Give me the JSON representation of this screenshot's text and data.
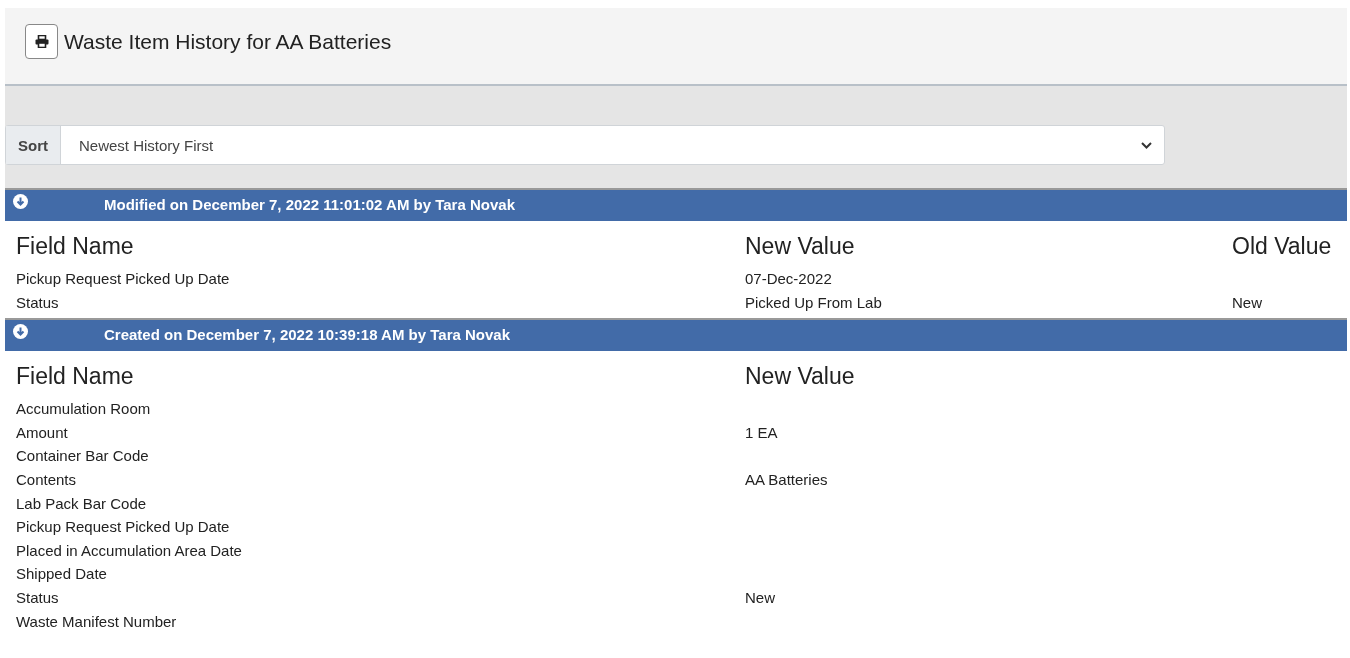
{
  "header": {
    "title": "Waste Item History for AA Batteries"
  },
  "sort": {
    "label": "Sort",
    "value": "Newest History First"
  },
  "sections": [
    {
      "title": "Modified on December 7, 2022 11:01:02 AM by Tara Novak",
      "columns": [
        "Field Name",
        "New Value",
        "Old Value"
      ],
      "rows": [
        {
          "field": "Pickup Request Picked Up Date",
          "new_value": "07-Dec-2022"
        },
        {
          "field": "Status",
          "new_value": "Picked Up From Lab",
          "old_value": "New"
        }
      ]
    },
    {
      "title": "Created on December 7, 2022 10:39:18 AM by Tara Novak",
      "columns": [
        "Field Name",
        "New Value"
      ],
      "rows": [
        {
          "field": "Accumulation Room"
        },
        {
          "field": "Amount",
          "new_value": "1 EA"
        },
        {
          "field": "Container Bar Code"
        },
        {
          "field": "Contents",
          "new_value": "AA Batteries"
        },
        {
          "field": "Lab Pack Bar Code"
        },
        {
          "field": "Pickup Request Picked Up Date"
        },
        {
          "field": "Placed in Accumulation Area Date"
        },
        {
          "field": "Shipped Date"
        },
        {
          "field": "Status",
          "new_value": "New"
        },
        {
          "field": "Waste Manifest Number"
        }
      ]
    }
  ]
}
